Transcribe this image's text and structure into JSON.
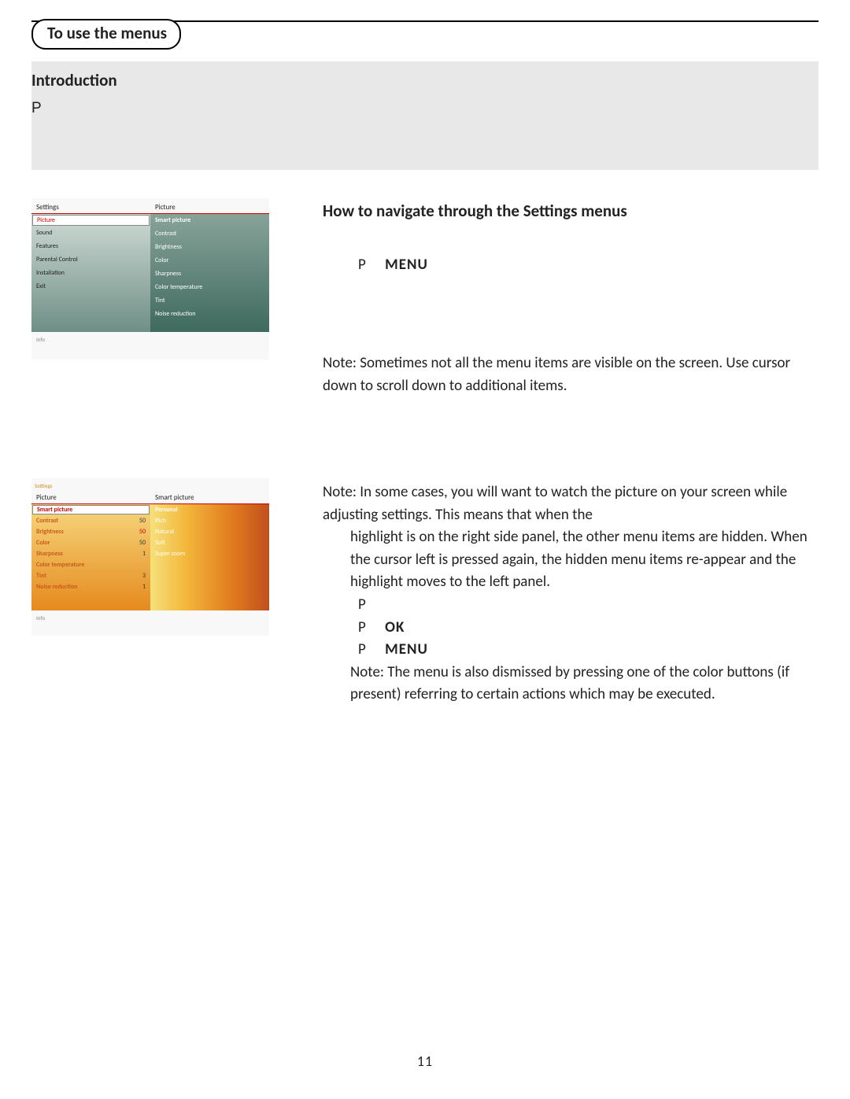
{
  "title_pill": "To use the menus",
  "intro": {
    "heading": "Introduction",
    "glyph": "P"
  },
  "nav_heading": "How to navigate through the Settings menus",
  "step1": {
    "glyph": "P",
    "kw": "MENU"
  },
  "note1": "Note: Sometimes not all the menu items are visible on the screen. Use cursor down to scroll down to additional items.",
  "note2a": "Note: In some cases, you will want to watch the picture on your screen while adjusting settings. This means that when the",
  "note2b": "highlight is on the right side panel, the other menu items are hidden. When the cursor left is pressed again, the hidden menu items re-appear and the highlight moves to the left panel.",
  "pblk": {
    "r1": {
      "g": "P"
    },
    "r2": {
      "g": "P",
      "kw": "OK"
    },
    "r3": {
      "g": "P",
      "kw": "MENU"
    }
  },
  "note3": "Note: The menu is also dismissed by pressing one of the color buttons (if present) referring to certain actions which may be executed.",
  "page_number": "11",
  "ss1": {
    "hdr_l": "Settings",
    "hdr_r": "Picture",
    "left": [
      "Picture",
      "Sound",
      "Features",
      "Parental Control",
      "Installation",
      "Exit"
    ],
    "right": [
      "Smart picture",
      "Contrast",
      "Brightness",
      "Color",
      "Sharpness",
      "Color temperature",
      "Tint",
      "Noise reduction"
    ],
    "info": "Info"
  },
  "ss2": {
    "back": "Settings",
    "hdr_l": "Picture",
    "hdr_r": "Smart picture",
    "left": [
      {
        "lbl": "Smart picture",
        "val": ""
      },
      {
        "lbl": "Contrast",
        "val": "50"
      },
      {
        "lbl": "Brightness",
        "val": "50"
      },
      {
        "lbl": "Color",
        "val": "50"
      },
      {
        "lbl": "Sharpness",
        "val": "1"
      },
      {
        "lbl": "Color temperature",
        "val": ""
      },
      {
        "lbl": "Tint",
        "val": "3"
      },
      {
        "lbl": "Noise reduction",
        "val": "1"
      }
    ],
    "right": [
      "Personal",
      "Rich",
      "Natural",
      "Soft",
      "Super zoom"
    ],
    "info": "Info"
  }
}
